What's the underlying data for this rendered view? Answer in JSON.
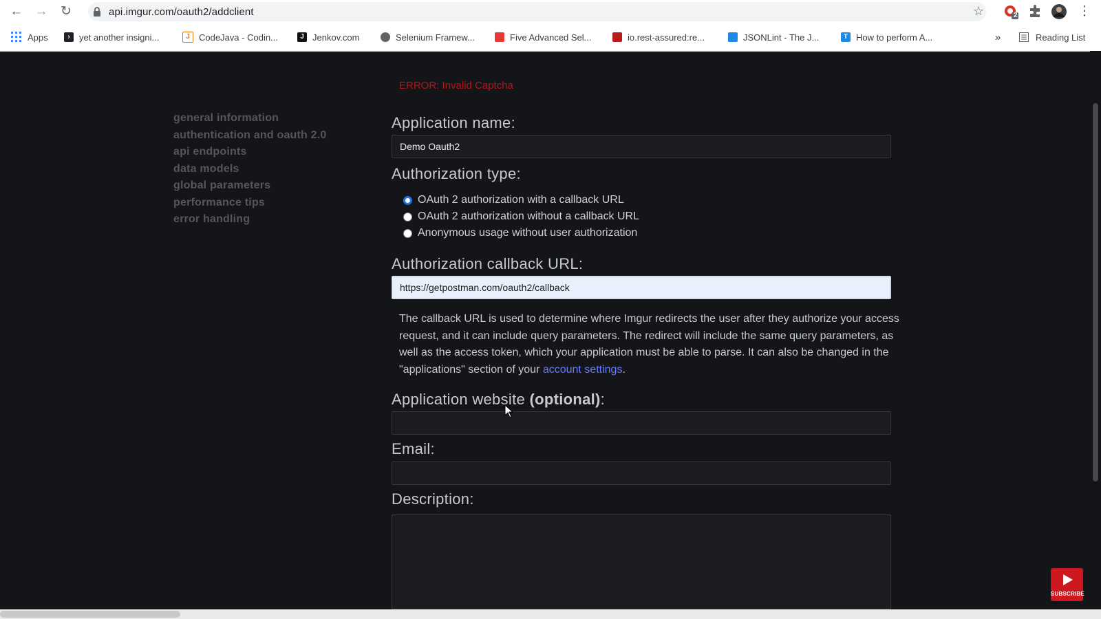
{
  "browser": {
    "url": "api.imgur.com/oauth2/addclient",
    "ext_badge": "2",
    "reading_list": "Reading List",
    "more": "»",
    "bookmarks": [
      {
        "label": "Apps",
        "icon": "apps-grid-icon",
        "color": "#4285f4"
      },
      {
        "label": "yet another insigni...",
        "icon": "terminal-icon",
        "color": "#202124"
      },
      {
        "label": "CodeJava - Codin...",
        "icon": "codejava-icon",
        "color": "#e8710a"
      },
      {
        "label": "Jenkov.com",
        "icon": "jenkov-icon",
        "color": "#111111"
      },
      {
        "label": "Selenium Framew...",
        "icon": "globe-icon",
        "color": "#5f6368"
      },
      {
        "label": "Five Advanced Sel...",
        "icon": "flame-icon",
        "color": "#e53935"
      },
      {
        "label": "io.rest-assured:re...",
        "icon": "maven-icon",
        "color": "#b71c1c"
      },
      {
        "label": "JSONLint - The J...",
        "icon": "jsonlint-icon",
        "color": "#1e88e5"
      },
      {
        "label": "How to perform A...",
        "icon": "tutorial-icon",
        "color": "#1e88e5"
      }
    ]
  },
  "sidebar": {
    "items": [
      {
        "label": "general information"
      },
      {
        "label": "authentication and oauth 2.0"
      },
      {
        "label": "api endpoints"
      },
      {
        "label": "data models"
      },
      {
        "label": "global parameters"
      },
      {
        "label": "performance tips"
      },
      {
        "label": "error handling"
      }
    ]
  },
  "form": {
    "error": "ERROR: Invalid Captcha",
    "app_name_label": "Application name:",
    "app_name_value": "Demo Oauth2",
    "auth_type_label": "Authorization type:",
    "auth_options": [
      {
        "label": "OAuth 2 authorization with a callback URL",
        "checked": true
      },
      {
        "label": "OAuth 2 authorization without a callback URL",
        "checked": false
      },
      {
        "label": "Anonymous usage without user authorization",
        "checked": false
      }
    ],
    "callback_label": "Authorization callback URL:",
    "callback_value": "https://getpostman.com/oauth2/callback",
    "help_text": "The callback URL is used to determine where Imgur redirects the user after they authorize your access request, and it can include query parameters. The redirect will include the same query parameters, as well as the access token, which your application must be able to parse. It can also be changed in the \"applications\" section of your",
    "help_link": "account settings",
    "help_end": ".",
    "website_label": "Application website",
    "website_optional": "(optional)",
    "website_colon": ":",
    "website_value": "",
    "email_label": "Email:",
    "email_value": "",
    "description_label": "Description:",
    "description_value": ""
  },
  "overlay": {
    "subscribe": "SUBSCRIBE"
  },
  "colors": {
    "background": "#141518",
    "error": "#b3161b",
    "link": "#6a78ff",
    "radio_checked": "#1a73e8"
  }
}
